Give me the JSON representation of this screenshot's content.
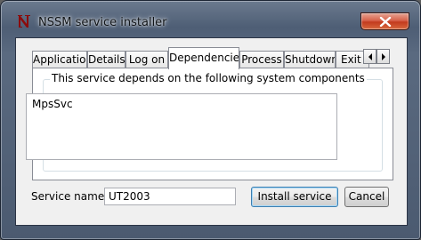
{
  "window": {
    "title": "NSSM service installer"
  },
  "tabs": [
    {
      "label": "Application",
      "active": false
    },
    {
      "label": "Details",
      "active": false
    },
    {
      "label": "Log on",
      "active": false
    },
    {
      "label": "Dependencies",
      "active": true
    },
    {
      "label": "Process",
      "active": false
    },
    {
      "label": "Shutdown",
      "active": false
    },
    {
      "label": "Exit",
      "active": false
    }
  ],
  "dependencies": {
    "group_label": "This service depends on the following system components",
    "items": [
      "MpsSvc"
    ]
  },
  "service": {
    "name_label": "Service name:",
    "name_value": "UT2003"
  },
  "buttons": {
    "install": "Install service",
    "cancel": "Cancel"
  },
  "icons": {
    "app": "nssm-n-icon",
    "close": "close-icon",
    "scroll_left": "arrow-left-icon",
    "scroll_right": "arrow-right-icon"
  },
  "colors": {
    "close_button": "#c33a1e",
    "title_text": "#101418"
  }
}
